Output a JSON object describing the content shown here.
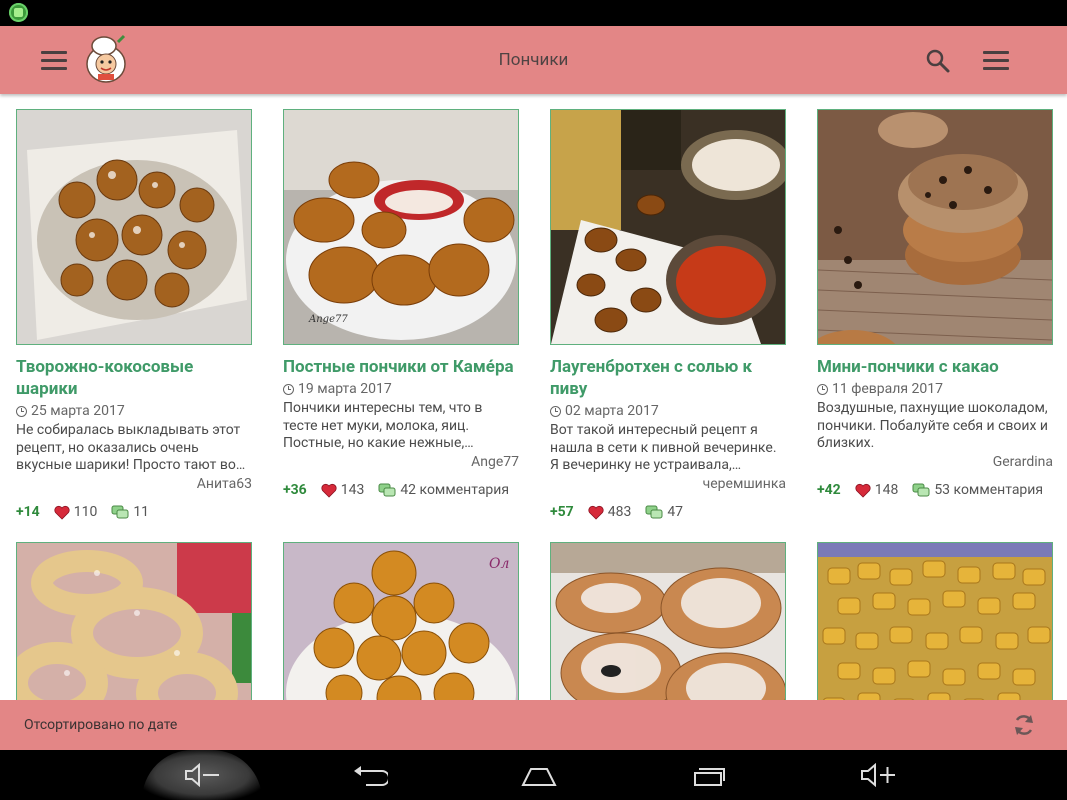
{
  "appbar": {
    "title": "Пончики"
  },
  "cards": [
    {
      "title": "Творожно-кокосовые шарики",
      "date": "25 марта 2017",
      "desc": "Не собиралась выкладывать этот рецепт, но оказались очень вкусные шарики! Просто тают во…",
      "author": "Анита63",
      "score": "+14",
      "likes": "110",
      "comments": "11"
    },
    {
      "title": "Постные пончики от Камéра",
      "date": "19 марта 2017",
      "desc": "Пончики интересны тем, что в тесте нет муки, молока, яиц. Постные, но какие нежные,…",
      "author": "Ange77",
      "score": "+36",
      "likes": "143",
      "comments": "42 комментария"
    },
    {
      "title": "Лаугенбротхен с солью к пиву",
      "date": "02 марта 2017",
      "desc": "Вот такой интересный рецепт я нашла в сети к пивной вечеринке. Я вечеринку не устраивала,…",
      "author": "черемшинка",
      "score": "+57",
      "likes": "483",
      "comments": "47"
    },
    {
      "title": "Мини-пончики с какао",
      "date": "11 февраля 2017",
      "desc": "Воздушные, пахнущие шоколадом, пончики. Побалуйте себя и своих и близких.",
      "author": "Gerardina",
      "score": "+42",
      "likes": "148",
      "comments": "53 комментария"
    }
  ],
  "sortbar": {
    "label": "Отсортировано по дате"
  },
  "icons": {
    "menu": "hamburger-icon",
    "search": "search-icon",
    "overflow": "overflow-menu-icon",
    "refresh": "refresh-icon",
    "clock": "clock-icon",
    "heart": "heart-icon",
    "comments": "comments-icon"
  },
  "colors": {
    "accent": "#e38686",
    "title_green": "#3f9a68",
    "score_green": "#2f8a3c",
    "heart_red": "#d62a3a"
  }
}
